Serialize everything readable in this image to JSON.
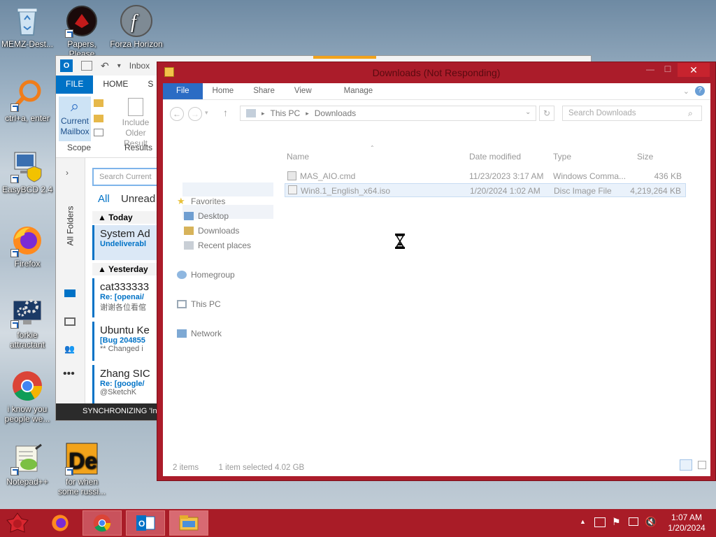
{
  "desktop": {
    "icons": [
      {
        "label": "MEMZ-Dest..."
      },
      {
        "label": "Papers, Please"
      },
      {
        "label": "Forza Horizon"
      },
      {
        "label": "ctrl+a, enter"
      },
      {
        "label": "EasyBCD 2.4"
      },
      {
        "label": "Firefox"
      },
      {
        "label": "forkie attractant"
      },
      {
        "label": "i know you people we..."
      },
      {
        "label": "Notepad++"
      },
      {
        "label": "for when some russi..."
      }
    ]
  },
  "outlook": {
    "title": "Inbox",
    "tabs": [
      "FILE",
      "HOME",
      "S"
    ],
    "ribbon": {
      "current_mailbox": "Current Mailbox",
      "scope_label": "Scope",
      "include_older": "Include Older Result",
      "results_label": "Results"
    },
    "all_folders": "All Folders",
    "search_placeholder": "Search Current",
    "filters": {
      "all": "All",
      "unread": "Unread"
    },
    "groups": {
      "today": "Today",
      "yesterday": "Yesterday"
    },
    "messages": [
      {
        "sender": "System Ad",
        "subject": "Undeliverabl",
        "preview": ""
      },
      {
        "sender": "cat333333",
        "subject": "Re: [openai/",
        "preview": "谢谢各位看倌"
      },
      {
        "sender": "Ubuntu Ke",
        "subject": "[Bug 204855",
        "preview": "** Changed i"
      },
      {
        "sender": "Zhang SIC",
        "subject": "Re: [google/",
        "preview": "@SketchK"
      }
    ],
    "status": "SYNCHRONIZING 'Ini"
  },
  "explorer": {
    "title": "Downloads (Not Responding)",
    "minimize": "—",
    "maximize": "☐",
    "close": "✕",
    "tabs": [
      "File",
      "Home",
      "Share",
      "View",
      "Manage"
    ],
    "breadcrumb": [
      "This PC",
      "Downloads"
    ],
    "search_placeholder": "Search Downloads",
    "nav": {
      "favorites": "Favorites",
      "desktop": "Desktop",
      "downloads": "Downloads",
      "recent": "Recent places",
      "homegroup": "Homegroup",
      "thispc": "This PC",
      "network": "Network"
    },
    "columns": {
      "name": "Name",
      "date": "Date modified",
      "type": "Type",
      "size": "Size"
    },
    "files": [
      {
        "name": "MAS_AIO.cmd",
        "date": "11/23/2023 3:17 AM",
        "type": "Windows Comma...",
        "size": "436 KB"
      },
      {
        "name": "Win8.1_English_x64.iso",
        "date": "1/20/2024 1:02 AM",
        "type": "Disc Image File",
        "size": "4,219,264 KB"
      }
    ],
    "status": {
      "count": "2 items",
      "selected": "1 item selected  4.02 GB"
    }
  },
  "taskbar": {
    "time": "1:07 AM",
    "date": "1/20/2024"
  },
  "colors": {
    "accent": "#ab1c2a",
    "taskbar": "#a91c27",
    "outlook_blue": "#0072c6"
  }
}
